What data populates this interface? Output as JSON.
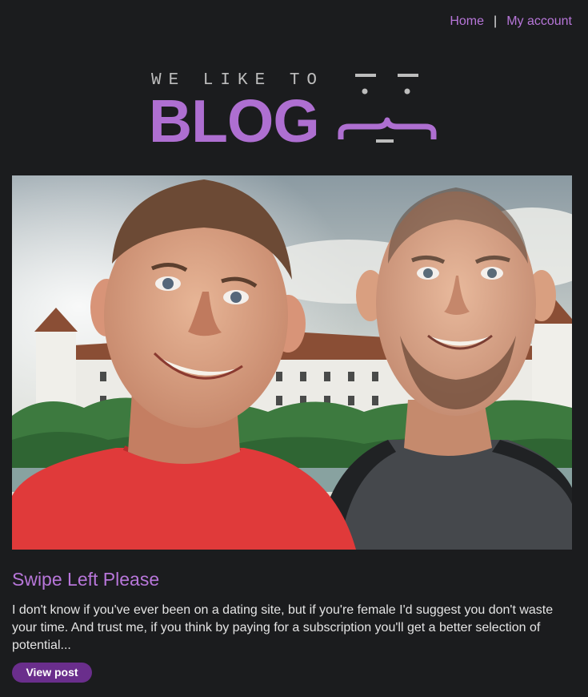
{
  "nav": {
    "home_label": "Home",
    "separator": "|",
    "account_label": "My account"
  },
  "logo": {
    "tagline": "WE LIKE TO",
    "wordmark": "BLOG"
  },
  "post": {
    "title": "Swipe Left Please",
    "excerpt": "I don't know if you've ever been on a dating site, but if you're female I'd suggest you don't waste your time. And trust me, if you think by paying for a subscription you'll get a better selection of potential...",
    "button_label": "View post"
  },
  "colors": {
    "background": "#1b1c1e",
    "accent": "#b776d9",
    "logo_purple": "#ae6fd1",
    "button": "#6a2e8c",
    "text": "#e4e4e4"
  }
}
